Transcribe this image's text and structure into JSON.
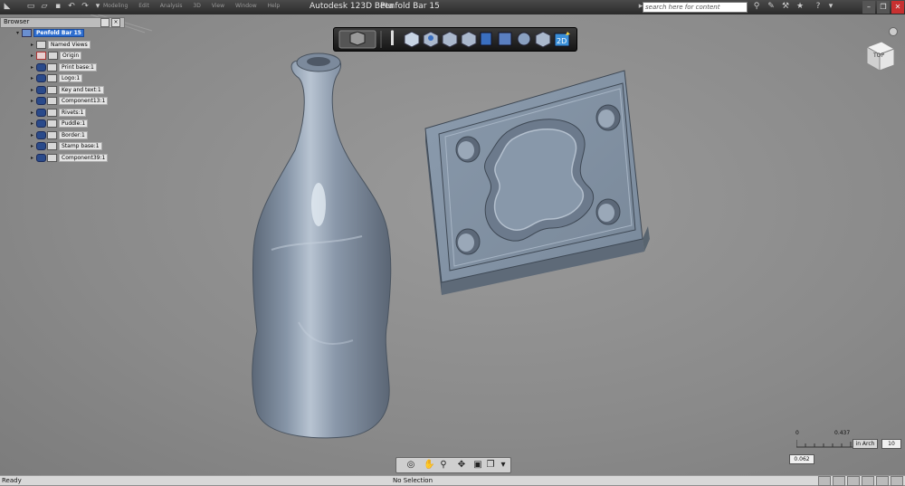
{
  "titlebar": {
    "app_title": "Autodesk 123D Beta",
    "doc_title": "Penfold Bar 15",
    "menu": [
      "Modeling",
      "Edit",
      "Analysis",
      "3D",
      "View",
      "Window",
      "Help"
    ],
    "search_placeholder": "search here for content"
  },
  "browser": {
    "title": "Browser",
    "root": "Penfold Bar 15",
    "items": [
      {
        "label": "Named Views",
        "eye": false
      },
      {
        "label": "Origin",
        "eye": false
      },
      {
        "label": "Print base:1",
        "eye": true
      },
      {
        "label": "Logo:1",
        "eye": true
      },
      {
        "label": "Key and text:1",
        "eye": true
      },
      {
        "label": "Component13:1",
        "eye": true
      },
      {
        "label": "Rivets:1",
        "eye": true
      },
      {
        "label": "Puddle:1",
        "eye": true
      },
      {
        "label": "Border:1",
        "eye": true
      },
      {
        "label": "Stamp base:1",
        "eye": true
      },
      {
        "label": "Component39:1",
        "eye": true
      }
    ]
  },
  "viewcube": {
    "face_label": "TOP"
  },
  "ruler": {
    "start": "0",
    "end": "0.437",
    "current_value": "0.062",
    "unit": "in Arch",
    "number": "10"
  },
  "status": {
    "left": "Ready",
    "center": "No Selection"
  },
  "colors": {
    "model": "#8ea0b4",
    "viewport_bg": "#8e8e8e",
    "selection": "#2f6fd0"
  }
}
